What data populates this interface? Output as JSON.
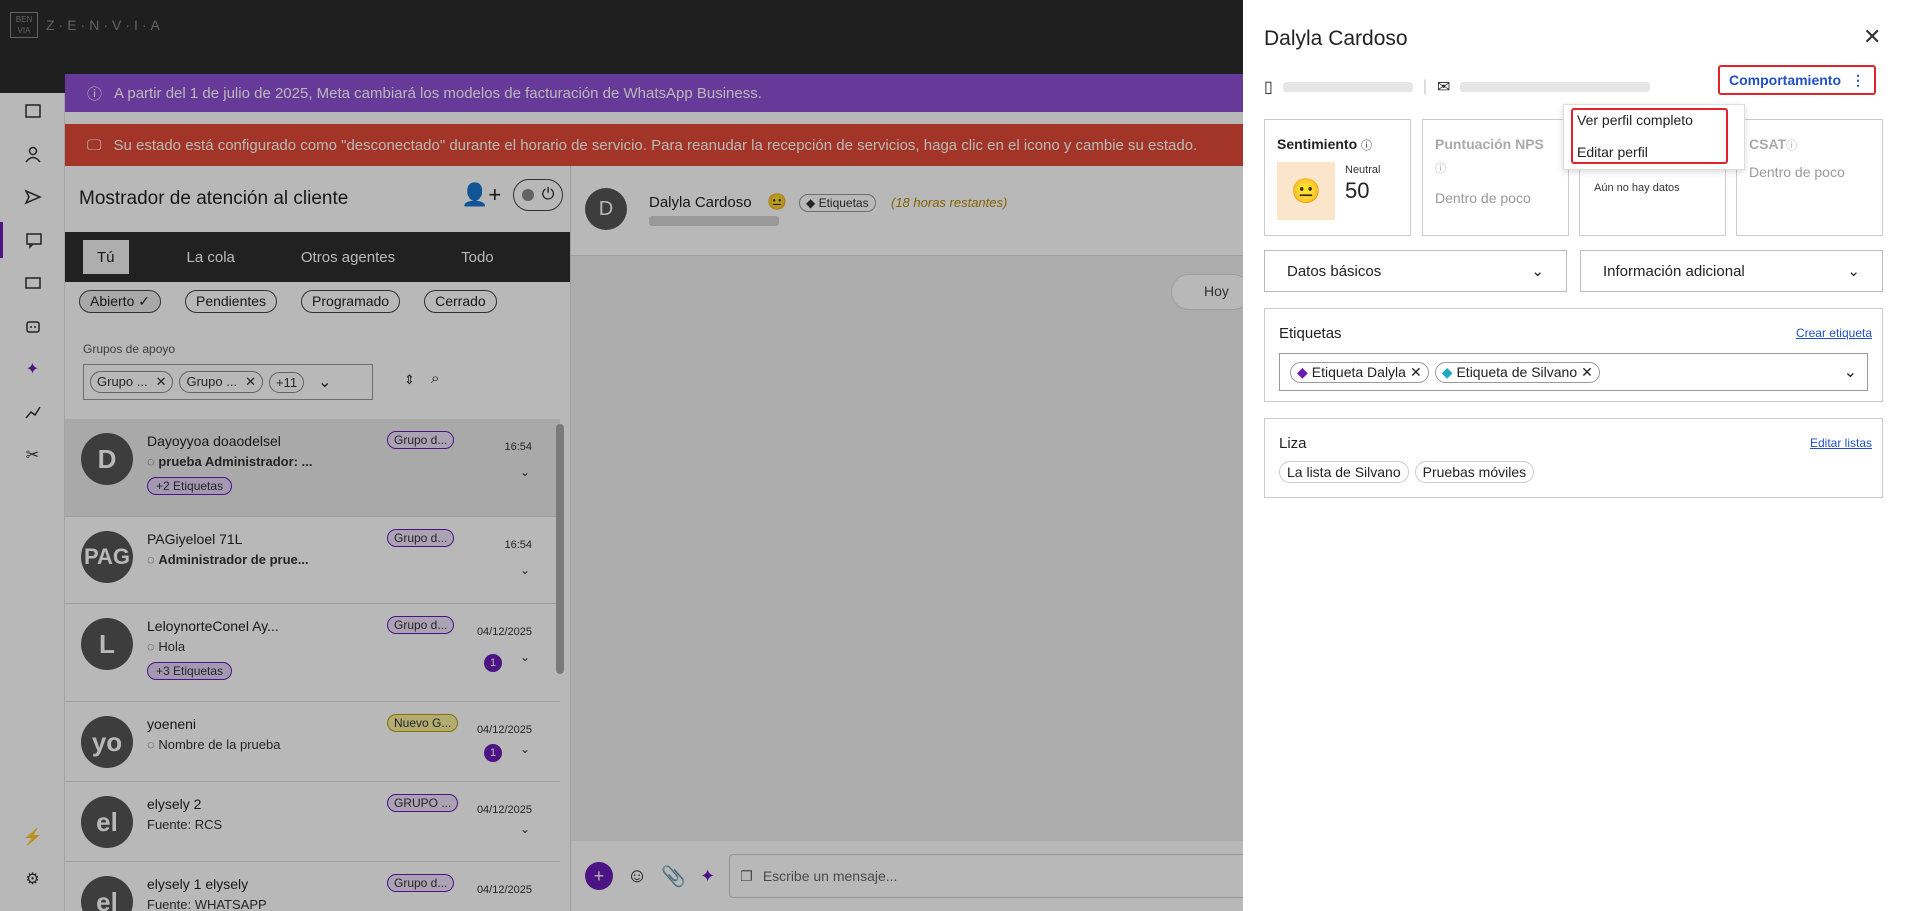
{
  "app": {
    "brand": "Z·E·N·V·I·A",
    "logo_text": "BEN VIA"
  },
  "banners": {
    "meta_notice": "A partir del 1 de julio de 2025, Meta cambiará los modelos de facturación de WhatsApp Business.",
    "status_warning": "Su estado está configurado como \"desconectado\" durante el horario de servicio. Para reanudar la recepción de servicios, haga clic en el icono y cambie su estado."
  },
  "inbox": {
    "title": "Mostrador de atención al cliente",
    "tabs": [
      "Tú",
      "La cola",
      "Otros agentes",
      "Todo"
    ],
    "filters": [
      "Abierto ✓",
      "Pendientes",
      "Programado",
      "Cerrado"
    ],
    "groups_label": "Grupos de apoyo",
    "group_chips": [
      "Grupo ...",
      "Grupo ..."
    ],
    "group_more": "+11",
    "conversations": [
      {
        "avatar": "D",
        "name": "Dayoyyoa doaodelsel",
        "msg": "prueba Administrador: ...",
        "group": "Grupo d...",
        "time": "16:54",
        "tag": "+2 Etiquetas"
      },
      {
        "avatar": "PAG",
        "name": "PAGiyeloel 71L",
        "msg": "Administrador de prue...",
        "group": "Grupo d...",
        "time": "16:54"
      },
      {
        "avatar": "L",
        "name": "LeloynorteConel Ay...",
        "msg": "Hola",
        "group": "Grupo d...",
        "time": "04/12/2025",
        "badge": "1",
        "tag": "+3 Etiquetas"
      },
      {
        "avatar": "yo",
        "name": "yoeneni",
        "msg": "Nombre de la prueba",
        "group": "Nuevo G...",
        "time": "04/12/2025",
        "badge": "1"
      },
      {
        "avatar": "el",
        "name": "elysely 2",
        "msg": "Fuente: RCS",
        "group": "GRUPO ...",
        "time": "04/12/2025"
      },
      {
        "avatar": "el",
        "name": "elysely 1 elysely",
        "msg": "Fuente: WHATSAPP",
        "group": "Grupo d...",
        "time": "04/12/2025"
      }
    ]
  },
  "chat": {
    "avatar": "D",
    "name": "Dalyla Cardoso",
    "tag_chip": "Etiquetas",
    "hours": "(18 horas restantes)",
    "today": "Hoy",
    "input_placeholder": "Escribe un mensaje..."
  },
  "profile": {
    "name": "Dalyla Cardoso",
    "behavior_button": "Comportamiento",
    "menu": [
      "Ver perfil completo",
      "Editar perfil"
    ],
    "cards": {
      "sentiment_title": "Sentimiento",
      "sentiment_label": "Neutral",
      "sentiment_value": "50",
      "nps_title": "Puntuación NPS",
      "nps_sub": "Dentro de poco",
      "third_sub": "Aún no hay datos",
      "csat_title": "CSAT",
      "csat_sub": "Dentro de poco"
    },
    "dropdowns": [
      "Datos básicos",
      "Información adicional"
    ],
    "labels": {
      "title": "Etiquetas",
      "link": "Crear etiqueta",
      "chips": [
        "Etiqueta Dalyla",
        "Etiqueta de Silvano"
      ]
    },
    "lists": {
      "title": "Liza",
      "link": "Editar listas",
      "chips": [
        "La lista de Silvano",
        "Pruebas móviles"
      ]
    }
  },
  "colors": {
    "accent": "#6a1bb7",
    "highlight": "#e2232d",
    "link": "#2250c8",
    "warning": "#e14a36",
    "notice": "#8f4fd3"
  }
}
